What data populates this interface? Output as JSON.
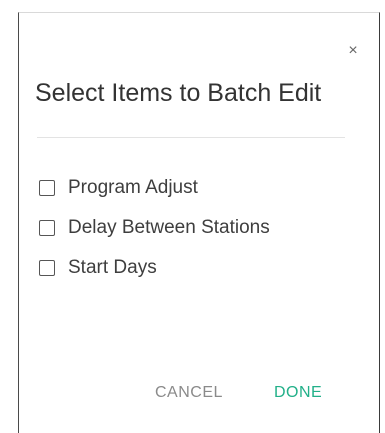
{
  "dialog": {
    "close_glyph": "×",
    "title": "Select Items to Batch Edit",
    "options": [
      {
        "label": "Program Adjust",
        "checked": false
      },
      {
        "label": "Delay Between Stations",
        "checked": false
      },
      {
        "label": "Start Days",
        "checked": false
      }
    ],
    "cancel_label": "CANCEL",
    "done_label": "DONE"
  },
  "colors": {
    "accent": "#22b089",
    "cancel": "#8a8a8a",
    "title": "#333333"
  },
  "icons": {
    "close": "close-icon",
    "checkbox": "checkbox-unchecked-icon"
  }
}
